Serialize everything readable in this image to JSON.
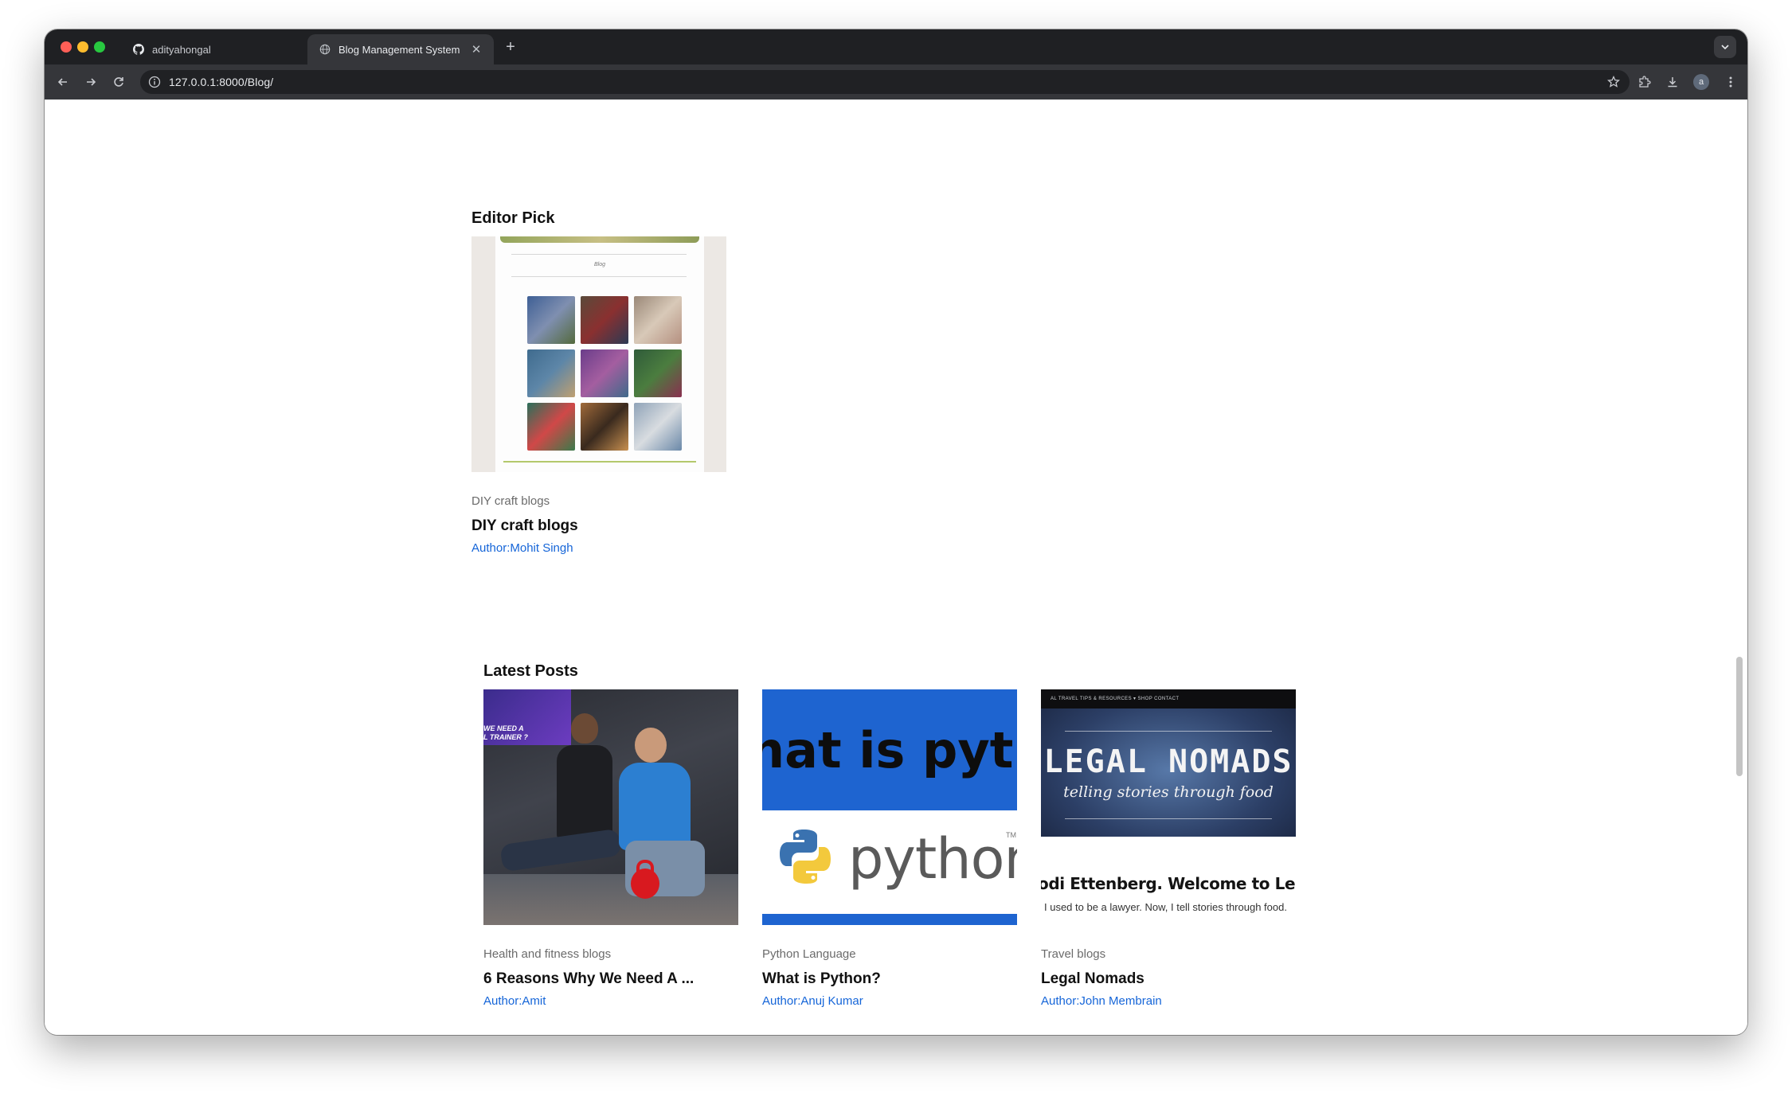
{
  "browser": {
    "tabs": [
      {
        "label": "adityahongal",
        "icon": "github-icon"
      },
      {
        "label": "Blog Management System :: Bl",
        "icon": "globe-icon"
      }
    ],
    "url": "127.0.0.1:8000/Blog/",
    "profile_initial": "a"
  },
  "editor_pick": {
    "section_title": "Editor Pick",
    "thumb_small_label": "Blog",
    "card": {
      "category": "DIY craft blogs",
      "title": "DIY craft blogs",
      "author": "Author:Mohit Singh"
    }
  },
  "latest_posts": {
    "section_title": "Latest Posts",
    "cards": [
      {
        "category": "Health and fitness blogs",
        "title": "6 Reasons Why We Need A ...",
        "author": "Author:Amit",
        "thumb_text": "WE NEED A\nL TRAINER ?"
      },
      {
        "category": "Python Language",
        "title": "What is Python?",
        "author": "Author:Anuj Kumar",
        "thumb_headline": "hat is pytho",
        "thumb_logo": "python",
        "thumb_tm": "TM"
      },
      {
        "category": "Travel blogs",
        "title": "Legal Nomads",
        "author": "Author:John Membrain",
        "thumb_nav": "AL   TRAVEL TIPS & RESOURCES ▾   SHOP   CONTACT",
        "thumb_title": "LEGAL NOMADS",
        "thumb_tagline": "telling stories through food",
        "thumb_welcome": "odi Ettenberg. Welcome to Legal N",
        "thumb_sub": "I used to be a lawyer. Now, I tell stories through food."
      }
    ]
  }
}
